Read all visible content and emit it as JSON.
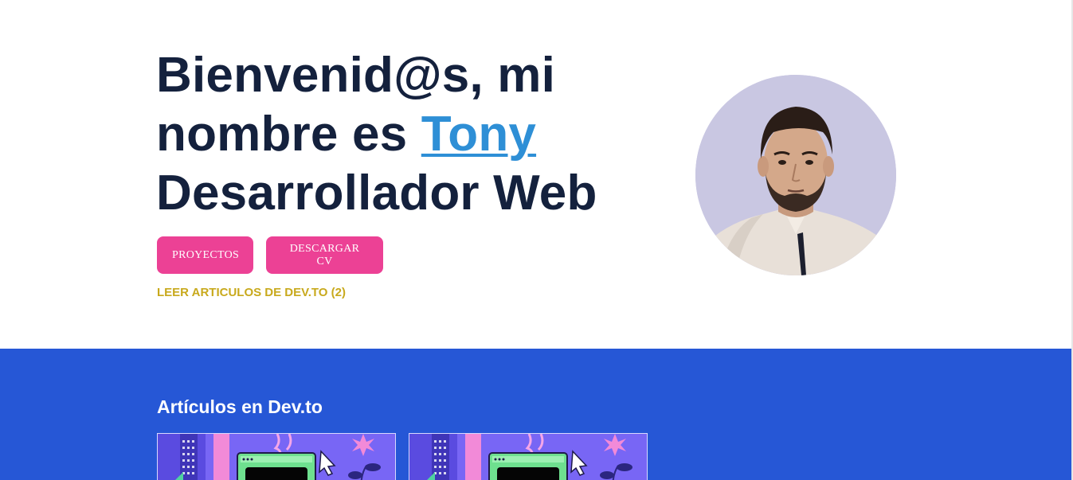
{
  "hero": {
    "title_line1": "Bienvenid@s, mi",
    "title_line2_prefix": "nombre es ",
    "title_name": "Tony",
    "title_line3": "Desarrollador Web",
    "buttons": {
      "projects_label": "PROYECTOS",
      "download_cv_label": "DESCARGAR CV"
    },
    "articles_link": "LEER ARTICULOS DE DEV.TO (2)",
    "avatar_alt": "Tony"
  },
  "articles": {
    "section_title": "Artículos en Dev.to",
    "cards": [
      {
        "image": "article-cover-illustration"
      },
      {
        "image": "article-cover-illustration"
      }
    ]
  },
  "colors": {
    "heading": "#14213d",
    "name_link": "#2e8fd6",
    "button_bg": "#ec4195",
    "articles_link": "#c8a91c",
    "section_bg": "#2657d6",
    "avatar_bg": "#c9c7e2"
  }
}
